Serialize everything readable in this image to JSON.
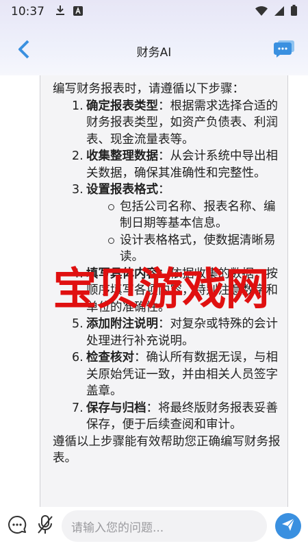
{
  "status_bar": {
    "time": "10:37"
  },
  "header": {
    "title": "财务AI"
  },
  "message": {
    "intro": "编写财务报表时，请遵循以下步骤：",
    "steps": [
      {
        "num": "1.",
        "title": "确定报表类型",
        "sep": "：",
        "text": "根据需求选择合适的财务报表类型，如资产负债表、利润表、现金流量表等。"
      },
      {
        "num": "2.",
        "title": "收集整理数据",
        "sep": "：",
        "text": "从会计系统中导出相关数据，确保其准确性和完整性。"
      },
      {
        "num": "3.",
        "title": "设置报表格式",
        "sep": "：",
        "text": ""
      },
      {
        "num": "4.",
        "title": "填写具体内容",
        "sep": "：",
        "text": "依据收集的数据，按顺序填写各项内容，特别注意数字和单位的准确性。"
      },
      {
        "num": "5.",
        "title": "添加附注说明",
        "sep": "：",
        "text": "对复杂或特殊的会计处理进行补充说明。"
      },
      {
        "num": "6.",
        "title": "检查核对",
        "sep": "：",
        "text": "确认所有数据无误，与相关原始凭证一致，并由相关人员签字盖章。"
      },
      {
        "num": "7.",
        "title": "保存与归档",
        "sep": "：",
        "text": "将最终版财务报表妥善保存，便于后续查阅和审计。"
      }
    ],
    "sub_items": [
      "包括公司名称、报表名称、编制日期等基本信息。",
      "设计表格格式，使数据清晰易读。"
    ],
    "outro": "遵循以上步骤能有效帮助您正确编写财务报表。"
  },
  "watermark": {
    "text": "宝贝游戏网"
  },
  "input": {
    "placeholder": "请输入您的问题..."
  },
  "colors": {
    "accent": "#3a90e0",
    "watermark": "#e01010"
  },
  "icons": [
    "download-icon",
    "a-box-icon",
    "wifi-icon",
    "signal-icon",
    "battery-icon",
    "back-icon",
    "chat-icon",
    "emoji-chat-icon",
    "mic-off-icon",
    "send-icon"
  ]
}
